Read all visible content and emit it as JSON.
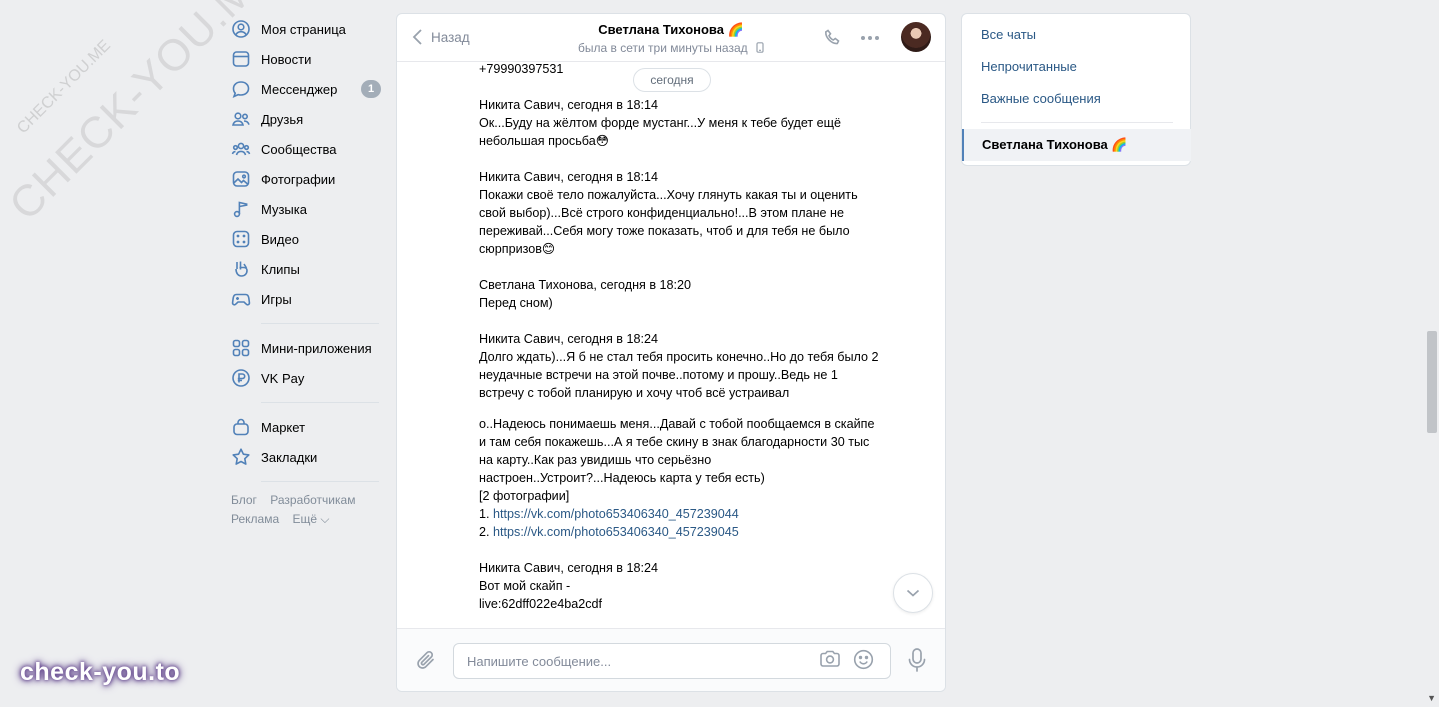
{
  "sidebar": {
    "items": [
      {
        "label": "Моя страница",
        "icon": "user-circle-icon"
      },
      {
        "label": "Новости",
        "icon": "newspaper-icon"
      },
      {
        "label": "Мессенджер",
        "icon": "chat-bubble-icon",
        "badge": "1"
      },
      {
        "label": "Друзья",
        "icon": "friends-icon"
      },
      {
        "label": "Сообщества",
        "icon": "communities-icon"
      },
      {
        "label": "Фотографии",
        "icon": "photo-icon"
      },
      {
        "label": "Музыка",
        "icon": "music-note-icon"
      },
      {
        "label": "Видео",
        "icon": "video-icon"
      },
      {
        "label": "Клипы",
        "icon": "clips-icon"
      },
      {
        "label": "Игры",
        "icon": "gamepad-icon"
      }
    ],
    "items2": [
      {
        "label": "Мини-приложения",
        "icon": "mini-apps-icon"
      },
      {
        "label": "VK Pay",
        "icon": "vk-pay-icon"
      }
    ],
    "items3": [
      {
        "label": "Маркет",
        "icon": "shopping-bag-icon"
      },
      {
        "label": "Закладки",
        "icon": "star-icon"
      }
    ],
    "footer": {
      "blog": "Блог",
      "developers": "Разработчикам",
      "ads": "Реклама",
      "more": "Ещё ⌵"
    }
  },
  "chat": {
    "back_label": "Назад",
    "peer_name": "Светлана Тихонова 🌈",
    "peer_status": "была в сети три минуты назад",
    "partial_top": "+79990397531",
    "date_divider": "сегодня",
    "messages": [
      {
        "header": "Никита Савич, сегодня в 18:14",
        "text": "Ок...Буду на жёлтом форде мустанг...У меня к тебе будет ещё небольшая просьба😳"
      },
      {
        "header": "Никита Савич, сегодня в 18:14",
        "text": "Покажи своё тело пожалуйста...Хочу глянуть какая ты и оценить свой выбор)...Всё строго конфиденциально!...В этом плане не переживай...Себя могу тоже показать, чтоб и для тебя не было сюрпризов😊"
      },
      {
        "header": "Светлана Тихонова, сегодня в 18:20",
        "text": "Перед сном)"
      },
      {
        "header": "Никита Савич, сегодня в 18:24",
        "text": "Долго ждать)...Я б не стал тебя просить конечно..Но до тебя было 2 неудачные встречи на этой почве..потому и прошу..Ведь не 1 встречу с тобой планирую и хочу чтоб всё устраивал"
      }
    ],
    "continuation": {
      "text": "о..Надеюсь понимаешь меня...Давай с тобой пообщаемся в скайпе и там себя покажешь...А я тебе скину в знак благодарности 30 тыс на карту..Как раз увидишь что серьёзно настроен..Устроит?...Надеюсь карта у тебя есть)",
      "attach_note": "[2 фотографии]",
      "link1_prefix": "1. ",
      "link1": "https://vk.com/photo653406340_457239044",
      "link2_prefix": "2. ",
      "link2": "https://vk.com/photo653406340_457239045"
    },
    "last_message": {
      "header": "Никита Савич, сегодня в 18:24",
      "text": "Вот мой скайп -\nlive:62dff022e4ba2cdf"
    },
    "input_placeholder": "Напишите сообщение..."
  },
  "right_panel": {
    "all_chats": "Все чаты",
    "unread": "Непрочитанные",
    "important": "Важные сообщения",
    "active_chat": "Светлана Тихонова 🌈"
  },
  "watermarks": {
    "diag_big": "CHECK-YOU.ME",
    "diag_small": "CHECK-YOU.ME",
    "logo": "check-you.to"
  }
}
